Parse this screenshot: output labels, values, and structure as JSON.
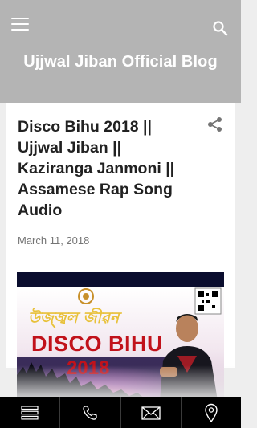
{
  "header": {
    "blog_title": "Ujjwal Jiban Official Blog",
    "menu_icon": "hamburger-menu-icon",
    "search_icon": "search-icon"
  },
  "post": {
    "title": "Disco Bihu 2018 || Ujjwal Jiban || Kaziranga Janmoni || Assamese Rap Song Audio",
    "date": "March 11, 2018",
    "share_icon": "share-icon",
    "thumbnail": {
      "script_text": "উজ্জ্বল জীৱন",
      "headline": "DISCO BIHU",
      "year": "2018"
    }
  },
  "bottom_bar": {
    "items": [
      {
        "icon": "menu-list-icon"
      },
      {
        "icon": "phone-icon"
      },
      {
        "icon": "mail-icon"
      },
      {
        "icon": "location-pin-icon"
      }
    ]
  },
  "colors": {
    "header_bg": "#b4b4b4",
    "page_bg": "#eeeeee",
    "title_text": "#212121",
    "date_text": "#757575",
    "bottom_bar_bg": "#000000"
  }
}
